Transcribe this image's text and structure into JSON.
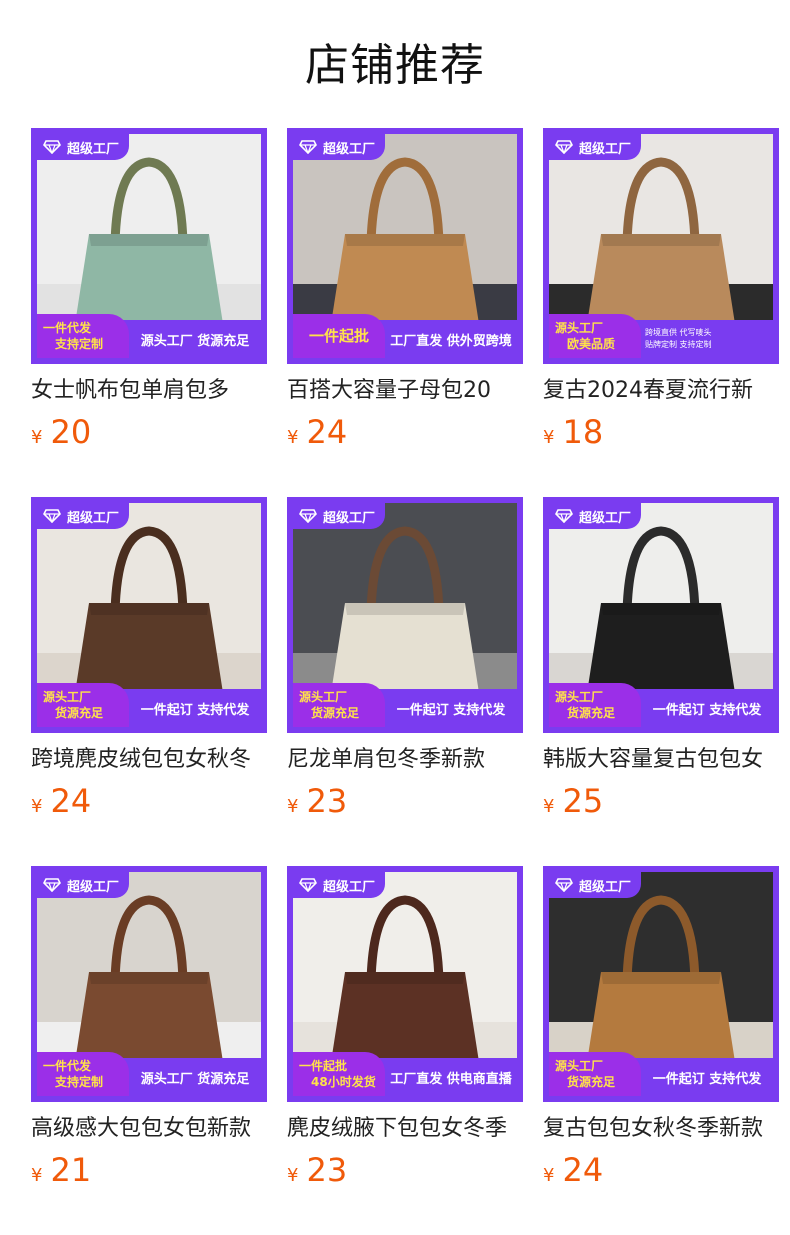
{
  "page": {
    "title": "店铺推荐"
  },
  "colors": {
    "badge_purple": "#7a3cf0",
    "price_orange": "#f05a0a",
    "promo_yellow": "#ffe24a"
  },
  "currency_symbol": "¥",
  "badge_label": "超级工厂",
  "badge_icon": "diamond-icon",
  "products": [
    {
      "title": "女士帆布包单肩包多",
      "price": "20",
      "promo_left": [
        "一件代发",
        "支持定制"
      ],
      "promo_right": "源头工厂 货源充足",
      "photo": "green canvas tote bag"
    },
    {
      "title": "百搭大容量子母包20",
      "price": "24",
      "promo_left": [
        "一件起批"
      ],
      "promo_right": "工厂直发 供外贸跨境",
      "photo": "tan shoulder bag held by person"
    },
    {
      "title": "复古2024春夏流行新",
      "price": "18",
      "promo_left": [
        "源头工厂",
        "欧美品质"
      ],
      "promo_right_lines": [
        "跨境直供 代写唛头",
        "贴牌定制 支持定制"
      ],
      "photo": "tan tote with pouch on shelf"
    },
    {
      "title": "跨境麂皮绒包包女秋冬",
      "price": "24",
      "promo_left": [
        "源头工厂",
        "货源充足"
      ],
      "promo_right": "一件起订 支持代发",
      "photo": "brown suede hobo bag"
    },
    {
      "title": "尼龙单肩包冬季新款",
      "price": "23",
      "promo_left": [
        "源头工厂",
        "货源充足"
      ],
      "promo_right": "一件起订 支持代发",
      "photo": "white nylon tote"
    },
    {
      "title": "韩版大容量复古包包女",
      "price": "25",
      "promo_left": [
        "源头工厂",
        "货源充足"
      ],
      "promo_right": "一件起订 支持代发",
      "photo": "black leather tote with scarf"
    },
    {
      "title": "高级感大包包女包新款",
      "price": "21",
      "promo_left": [
        "一件代发",
        "支持定制"
      ],
      "promo_right": "源头工厂 货源充足",
      "photo": "brown leather tote"
    },
    {
      "title": "麂皮绒腋下包包女冬季",
      "price": "23",
      "promo_left": [
        "一件起批",
        "48小时发货"
      ],
      "promo_right": "工厂直发 供电商直播",
      "photo": "brown suede bag with pouch"
    },
    {
      "title": "复古包包女秋冬季新款",
      "price": "24",
      "promo_left": [
        "源头工厂",
        "货源充足"
      ],
      "promo_right": "一件起订 支持代发",
      "photo": "caramel leather hobo bag"
    }
  ]
}
